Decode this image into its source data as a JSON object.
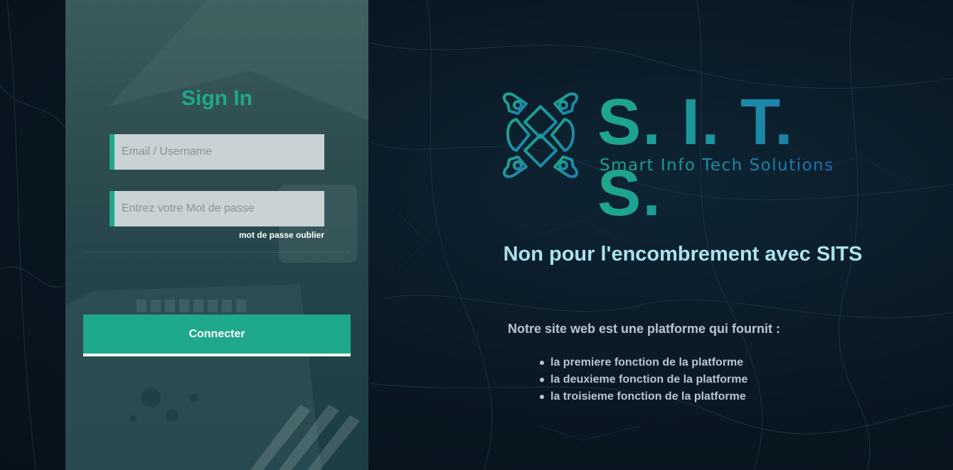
{
  "login": {
    "title": "Sign In",
    "email_placeholder": "Email / Username",
    "password_placeholder": "Entrez votre Mot de passe",
    "forgot_link": "mot de passe oublier",
    "submit_label": "Connecter"
  },
  "brand": {
    "name": "S. I. T. S.",
    "tagline": "Smart Info Tech Solutions",
    "accent_color": "#1ea98a",
    "secondary_color": "#1f6fb2"
  },
  "hero": {
    "headline": "Non pour l'encombrement avec SITS",
    "intro": "Notre site web est une platforme qui fournit :",
    "features": [
      "la premiere fonction de la platforme",
      "la deuxieme fonction de la platforme",
      "la troisieme fonction de la platforme"
    ]
  },
  "icons": {
    "logo": "puzzle-cross-logo-icon",
    "bullet": "disc-bullet-icon"
  }
}
